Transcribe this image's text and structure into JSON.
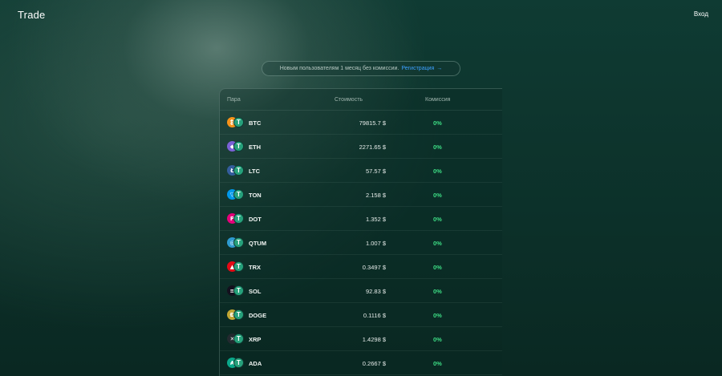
{
  "header": {
    "brand": "Trade",
    "login_label": "Вход"
  },
  "promo": {
    "text": "Новым пользователям 1 месяц без комиссии.",
    "link_label": "Регистрация",
    "arrow": "→"
  },
  "table": {
    "columns": {
      "pair": "Пара",
      "price": "Стоимость",
      "fee": "Комиссия"
    },
    "quote_icon": "usdt-icon",
    "rows": [
      {
        "symbol": "BTC",
        "price": "79815.7 $",
        "fee": "0%",
        "icon": "btc-icon",
        "color": "#f7931a",
        "glyph": "₿"
      },
      {
        "symbol": "ETH",
        "price": "2271.65 $",
        "fee": "0%",
        "icon": "eth-icon",
        "color": "#7b61d6",
        "glyph": "◆"
      },
      {
        "symbol": "LTC",
        "price": "57.57 $",
        "fee": "0%",
        "icon": "ltc-icon",
        "color": "#345d9d",
        "glyph": "Ł"
      },
      {
        "symbol": "TON",
        "price": "2.158 $",
        "fee": "0%",
        "icon": "ton-icon",
        "color": "#0098ea",
        "glyph": "▽"
      },
      {
        "symbol": "DOT",
        "price": "1.352 $",
        "fee": "0%",
        "icon": "dot-icon",
        "color": "#e6007a",
        "glyph": "P"
      },
      {
        "symbol": "QTUM",
        "price": "1.007 $",
        "fee": "0%",
        "icon": "qtum-icon",
        "color": "#2e9ad0",
        "glyph": "◎"
      },
      {
        "symbol": "TRX",
        "price": "0.3497 $",
        "fee": "0%",
        "icon": "trx-icon",
        "color": "#e50915",
        "glyph": "▲"
      },
      {
        "symbol": "SOL",
        "price": "92.83 $",
        "fee": "0%",
        "icon": "sol-icon",
        "color": "#14101e",
        "glyph": "≡"
      },
      {
        "symbol": "DOGE",
        "price": "0.1116 $",
        "fee": "0%",
        "icon": "doge-icon",
        "color": "#c2a633",
        "glyph": "Ð"
      },
      {
        "symbol": "XRP",
        "price": "1.4298 $",
        "fee": "0%",
        "icon": "xrp-icon",
        "color": "#23292f",
        "glyph": "✕"
      },
      {
        "symbol": "ADA",
        "price": "0.2667 $",
        "fee": "0%",
        "icon": "ada-icon",
        "color": "#0aa88a",
        "glyph": "₳"
      }
    ]
  }
}
